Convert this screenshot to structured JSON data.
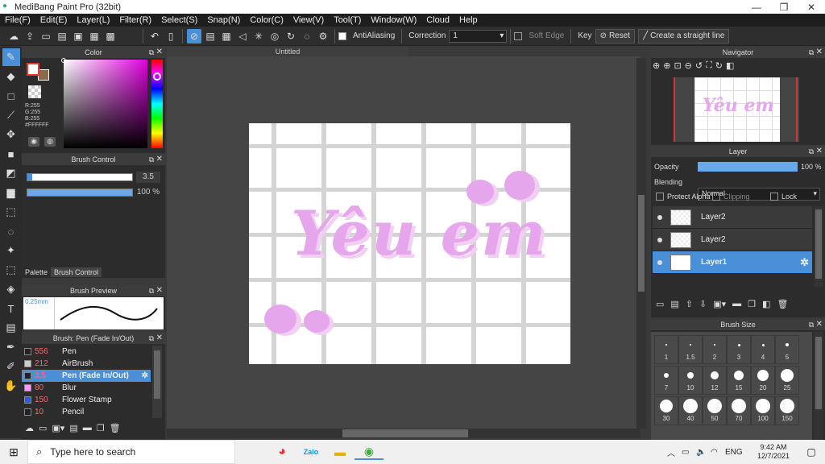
{
  "window": {
    "title": "MediBang Paint Pro (32bit)",
    "minimize": "—",
    "maximize": "❐",
    "close": "✕"
  },
  "menu": [
    "File(F)",
    "Edit(E)",
    "Layer(L)",
    "Filter(R)",
    "Select(S)",
    "Snap(N)",
    "Color(C)",
    "View(V)",
    "Tool(T)",
    "Window(W)",
    "Cloud",
    "Help"
  ],
  "toolbar": {
    "antialiasing": "AntiAliasing",
    "correction_label": "Correction",
    "correction_value": "1",
    "soft_edge": "Soft Edge",
    "key": "Key",
    "reset": "Reset",
    "straight_line": "Create a straight line"
  },
  "color_panel": {
    "title": "Color",
    "r": "R:255",
    "g": "G:255",
    "b": "B:255",
    "hex": "#FFFFFF"
  },
  "brush_control": {
    "title": "Brush Control",
    "size": "3.5",
    "opacity": "100 %",
    "size_fill": 0.35,
    "opacity_fill": 1.0
  },
  "tabs": {
    "palette": "Palette",
    "brush_control": "Brush Control"
  },
  "brush_preview": {
    "title": "Brush Preview",
    "size": "0.25mm"
  },
  "brush_list": {
    "title": "Brush: Pen (Fade In/Out)",
    "items": [
      {
        "size": "556",
        "name": "Pen",
        "color": "#222222"
      },
      {
        "size": "212",
        "name": "AirBrush",
        "color": "#cccccc"
      },
      {
        "size": "3.5",
        "name": "Pen (Fade In/Out)",
        "color": "#222222",
        "selected": true
      },
      {
        "size": "80",
        "name": "Blur",
        "color": "#ff99ff"
      },
      {
        "size": "150",
        "name": "Flower Stamp",
        "color": "#3355ff"
      },
      {
        "size": "10",
        "name": "Pencil",
        "color": "#222222"
      }
    ]
  },
  "document": {
    "tab": "Untitled",
    "text": "Yêu em"
  },
  "navigator": {
    "title": "Navigator"
  },
  "layer_panel": {
    "title": "Layer",
    "opacity_label": "Opacity",
    "opacity_value": "100 %",
    "blending_label": "Blending",
    "blending_value": "Normal",
    "protect_alpha": "Protect Alpha",
    "clipping": "Clipping",
    "lock": "Lock",
    "layers": [
      {
        "name": "Layer2"
      },
      {
        "name": "Layer2"
      },
      {
        "name": "Layer1",
        "selected": true
      }
    ]
  },
  "brush_size": {
    "title": "Brush Size",
    "sizes": [
      "1",
      "1.5",
      "2",
      "3",
      "4",
      "5",
      "7",
      "10",
      "12",
      "15",
      "20",
      "25",
      "30",
      "40",
      "50",
      "70",
      "100",
      "150"
    ]
  },
  "taskbar": {
    "search": "Type here to search",
    "lang": "ENG",
    "time": "9:42 AM",
    "date": "12/7/2021"
  },
  "colors": {
    "accent": "#4a90d9",
    "pink": "#e6a6ec",
    "fg": "#ffffff"
  }
}
